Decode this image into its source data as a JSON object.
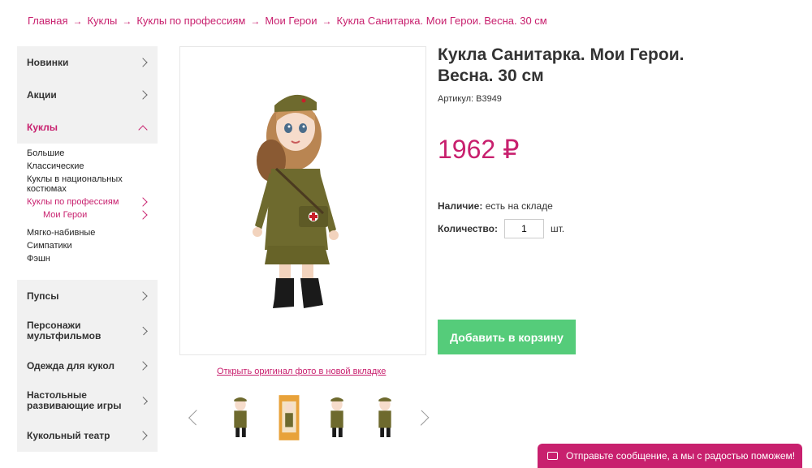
{
  "breadcrumb": [
    "Главная",
    "Куклы",
    "Куклы по профессиям",
    "Мои Герои",
    "Кукла Санитарка. Мои Герои. Весна. 30 см"
  ],
  "sidebar": {
    "novinki": "Новинки",
    "akcii": "Акции",
    "kukly": "Куклы",
    "sub": {
      "bolshie": "Большие",
      "klassicheskie": "Классические",
      "nacionalnye": "Куклы в национальных костюмах",
      "professii": "Куклы по профессиям",
      "moi_geroi": "Мои Герои",
      "myagko": "Мягко-набивные",
      "simpatiki": "Симпатики",
      "feshn": "Фэшн"
    },
    "pupsy": "Пупсы",
    "personazhi": "Персонажи мультфильмов",
    "odezhda": "Одежда для кукол",
    "nastolnye": "Настольные развивающие игры",
    "teatr": "Кукольный театр"
  },
  "product": {
    "title": "Кукла Санитарка. Мои Герои. Весна. 30 см",
    "sku": "Артикул: В3949",
    "price": "1962 ₽",
    "availability_label": "Наличие:",
    "availability_value": "есть на складе",
    "quantity_label": "Количество:",
    "quantity_value": "1",
    "quantity_unit": "шт.",
    "add_to_cart": "Добавить в корзину",
    "photo_link": "Открыть оригинал фото в новой вкладке"
  },
  "chat": {
    "label": "Отправьте сообщение, а мы с радостью поможем!"
  },
  "colors": {
    "accent": "#c8206e",
    "button": "#55cc7a"
  },
  "icons": [
    "chevron-right-icon",
    "chevron-up-icon",
    "mail-icon",
    "arrow-right-icon"
  ]
}
